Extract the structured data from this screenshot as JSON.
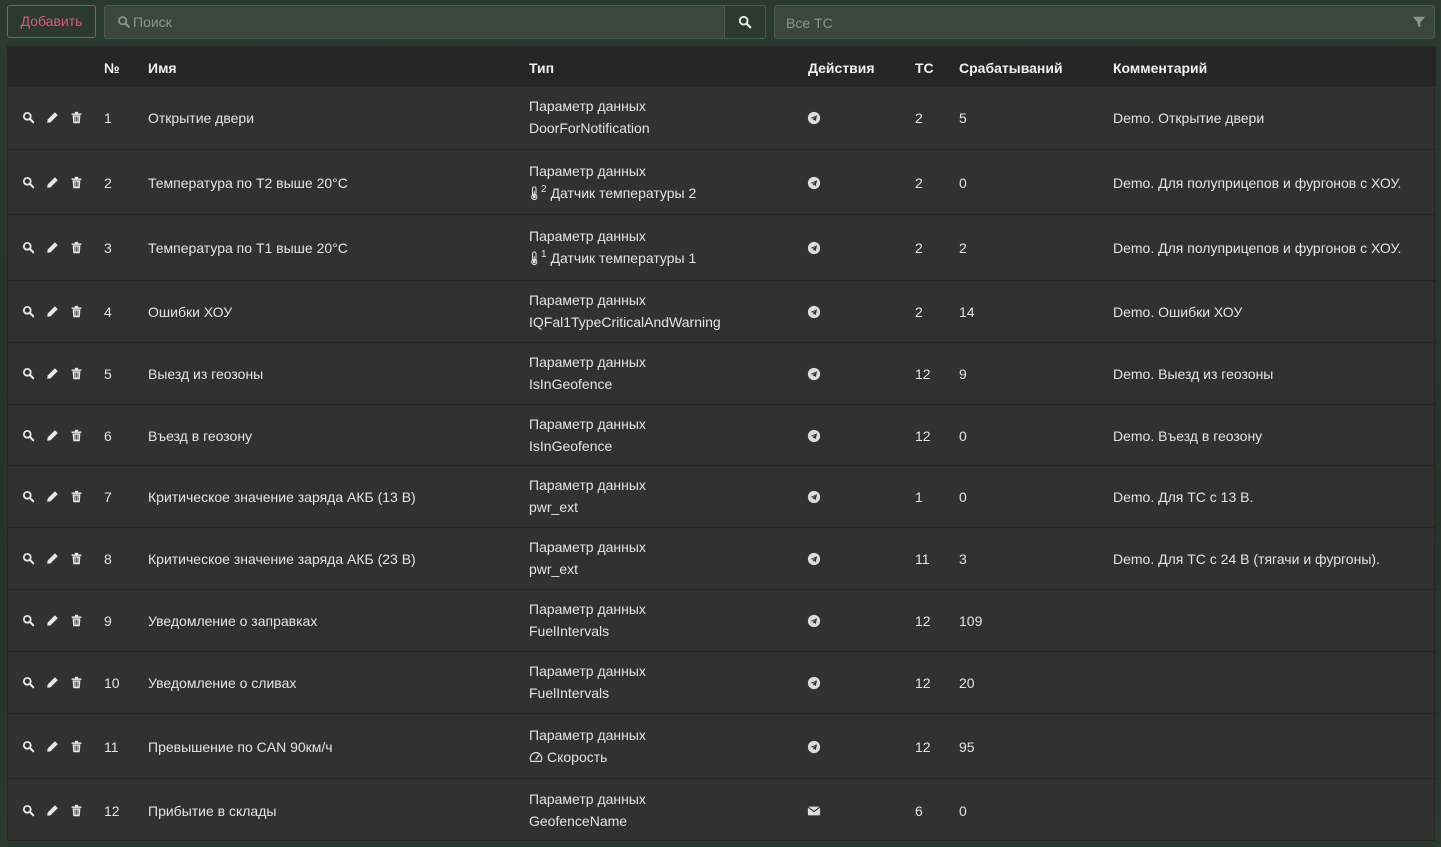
{
  "toolbar": {
    "add_label": "Добавить",
    "search_placeholder": "Поиск",
    "vehicle_filter_label": "Все ТС"
  },
  "table": {
    "headers": {
      "num": "№",
      "name": "Имя",
      "type": "Тип",
      "actions": "Действия",
      "vehicles": "ТС",
      "triggers": "Срабатываний",
      "comment": "Комментарий"
    },
    "rows": [
      {
        "num": "1",
        "name": "Открытие двери",
        "type": "Параметр данных",
        "param": "DoorForNotification",
        "param_icon": "",
        "action": "telegram-icon",
        "vehicles": "2",
        "triggers": "5",
        "comment": "Demo. Открытие двери"
      },
      {
        "num": "2",
        "name": "Температура по Т2 выше 20°С",
        "type": "Параметр данных",
        "param": "Датчик температуры 2",
        "param_icon": "thermometer-2-icon",
        "action": "telegram-icon",
        "vehicles": "2",
        "triggers": "0",
        "comment": "Demo. Для полуприцепов и фургонов с ХОУ."
      },
      {
        "num": "3",
        "name": "Температура по Т1 выше 20°С",
        "type": "Параметр данных",
        "param": "Датчик температуры 1",
        "param_icon": "thermometer-1-icon",
        "action": "telegram-icon",
        "vehicles": "2",
        "triggers": "2",
        "comment": "Demo. Для полуприцепов и фургонов с ХОУ."
      },
      {
        "num": "4",
        "name": "Ошибки ХОУ",
        "type": "Параметр данных",
        "param": "IQFal1TypeCriticalAndWarning",
        "param_icon": "",
        "action": "telegram-icon",
        "vehicles": "2",
        "triggers": "14",
        "comment": "Demo. Ошибки ХОУ"
      },
      {
        "num": "5",
        "name": "Выезд из геозоны",
        "type": "Параметр данных",
        "param": "IsInGeofence",
        "param_icon": "",
        "action": "telegram-icon",
        "vehicles": "12",
        "triggers": "9",
        "comment": "Demo. Выезд из геозоны"
      },
      {
        "num": "6",
        "name": "Въезд в геозону",
        "type": "Параметр данных",
        "param": "IsInGeofence",
        "param_icon": "",
        "action": "telegram-icon",
        "vehicles": "12",
        "triggers": "0",
        "comment": "Demo. Въезд в геозону"
      },
      {
        "num": "7",
        "name": "Критическое значение заряда АКБ (13 В)",
        "type": "Параметр данных",
        "param": "pwr_ext",
        "param_icon": "",
        "action": "telegram-icon",
        "vehicles": "1",
        "triggers": "0",
        "comment": "Demo. Для ТС с 13 В."
      },
      {
        "num": "8",
        "name": "Критическое значение заряда АКБ (23 В)",
        "type": "Параметр данных",
        "param": "pwr_ext",
        "param_icon": "",
        "action": "telegram-icon",
        "vehicles": "11",
        "triggers": "3",
        "comment": "Demo. Для ТС с 24 В (тягачи и фургоны)."
      },
      {
        "num": "9",
        "name": "Уведомление о заправках",
        "type": "Параметр данных",
        "param": "FuelIntervals",
        "param_icon": "",
        "action": "telegram-icon",
        "vehicles": "12",
        "triggers": "109",
        "comment": ""
      },
      {
        "num": "10",
        "name": "Уведомление о сливах",
        "type": "Параметр данных",
        "param": "FuelIntervals",
        "param_icon": "",
        "action": "telegram-icon",
        "vehicles": "12",
        "triggers": "20",
        "comment": ""
      },
      {
        "num": "11",
        "name": "Превышение по CAN 90км/ч",
        "type": "Параметр данных",
        "param": "Скорость",
        "param_icon": "speedometer-icon",
        "action": "telegram-icon",
        "vehicles": "12",
        "triggers": "95",
        "comment": ""
      },
      {
        "num": "12",
        "name": "Прибытие в склады",
        "type": "Параметр данных",
        "param": "GeofenceName",
        "param_icon": "",
        "action": "envelope-icon",
        "vehicles": "6",
        "triggers": "0",
        "comment": ""
      }
    ]
  }
}
